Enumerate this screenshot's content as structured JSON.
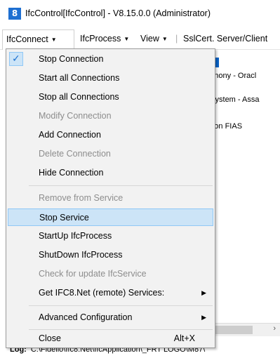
{
  "window": {
    "title": "IfcControl[IfcControl] - V8.15.0.0 (Administrator)",
    "icon": "app-logo-icon",
    "icon_text": "8"
  },
  "menubar": {
    "items": [
      "IfcConnect",
      "IfcProcess",
      "View",
      "SslCert. Server/Client"
    ],
    "separator": "|"
  },
  "menu": {
    "items": [
      {
        "label": "Stop Connection",
        "checked": true
      },
      {
        "label": "Start all Connections"
      },
      {
        "label": "Stop all Connections"
      },
      {
        "label": "Modify Connection",
        "disabled": true
      },
      {
        "label": "Add Connection"
      },
      {
        "label": "Delete Connection",
        "disabled": true
      },
      {
        "label": "Hide Connection"
      },
      {
        "label": "Remove from Service",
        "disabled": true
      },
      {
        "label": "Stop Service",
        "highlighted": true
      },
      {
        "label": "StartUp IfcProcess"
      },
      {
        "label": "ShutDown IfcProcess"
      },
      {
        "label": "Check for update IfcService",
        "disabled": true
      },
      {
        "label": "Get IFC8.Net (remote) Services:",
        "submenu": true
      },
      {
        "label": "Advanced Configuration",
        "submenu": true
      },
      {
        "label": "Close",
        "shortcut": "Alt+X"
      }
    ]
  },
  "background": {
    "tree_lines": [
      "─)",
      "mphony - Oracl",
      "─)",
      "g System - Assa",
      "ed on FIAS"
    ],
    "log_label": "Log:",
    "log_text": "C:\\Fidelio\\Ifc8.Net\\IfcApplication\\_FRT LOGO\\M87\\",
    "scroll_right": "›"
  }
}
